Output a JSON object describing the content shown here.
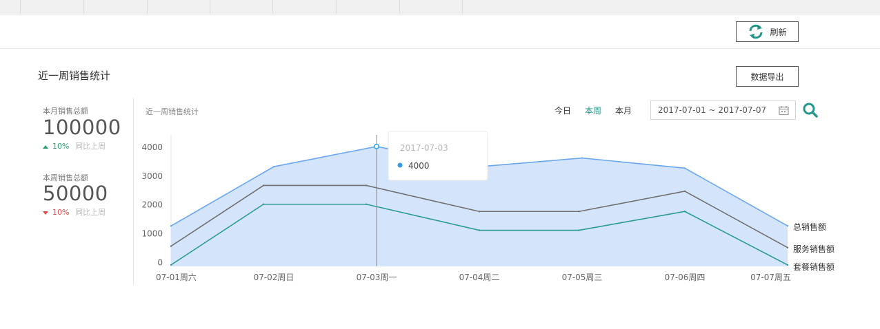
{
  "nav": {
    "tabs": [
      "",
      "",
      "",
      "",
      "",
      "",
      ""
    ]
  },
  "toolbar": {
    "refresh_label": "刷新"
  },
  "page": {
    "title": "近一周销售统计",
    "export_label": "数据导出"
  },
  "stats": {
    "month": {
      "label": "本月销售总额",
      "value": "100000",
      "change": "10%",
      "compare": "同比上周",
      "direction": "up"
    },
    "week": {
      "label": "本周销售总额",
      "value": "50000",
      "change": "10%",
      "compare": "同比上周",
      "direction": "down"
    }
  },
  "chart_header": {
    "title": "近一周销售统计",
    "ranges": [
      {
        "label": "今日",
        "active": false
      },
      {
        "label": "本周",
        "active": true
      },
      {
        "label": "本月",
        "active": false
      }
    ],
    "date_range": "2017-07-01 ~ 2017-07-07"
  },
  "chart_data": {
    "type": "line",
    "title": "",
    "xlabel": "",
    "ylabel": "",
    "categories": [
      "07-01周六",
      "07-02周日",
      "07-03周一",
      "07-04周二",
      "07-05周三",
      "07-06周四",
      "07-07周五"
    ],
    "y_ticks": [
      "0",
      "1000",
      "2000",
      "3000",
      "4000"
    ],
    "ylim": [
      -150,
      4400
    ],
    "series": [
      {
        "name": "总销售额",
        "color": "#6aa6f0",
        "fill": "#d3e4fb",
        "area": true,
        "x": [
          0,
          1,
          2,
          3,
          4,
          5,
          6
        ],
        "values": [
          1250,
          3300,
          4000,
          3300,
          3600,
          3250,
          1250
        ]
      },
      {
        "name": "服务销售额",
        "color": "#6f6f6f",
        "area": false,
        "x": [
          0,
          0.9,
          1.9,
          3,
          3.97,
          5,
          6
        ],
        "values": [
          550,
          2650,
          2650,
          1750,
          1750,
          2450,
          500
        ]
      },
      {
        "name": "套餐销售额",
        "color": "#2a9a93",
        "area": false,
        "x": [
          0,
          0.9,
          1.9,
          3,
          3.97,
          5,
          6
        ],
        "values": [
          -100,
          2000,
          2000,
          1100,
          1100,
          1750,
          -100
        ]
      }
    ],
    "tooltip": {
      "date": "2017-07-03",
      "value": "4000",
      "category_index": 2
    },
    "grid": false,
    "legend": "right-end-labels"
  }
}
